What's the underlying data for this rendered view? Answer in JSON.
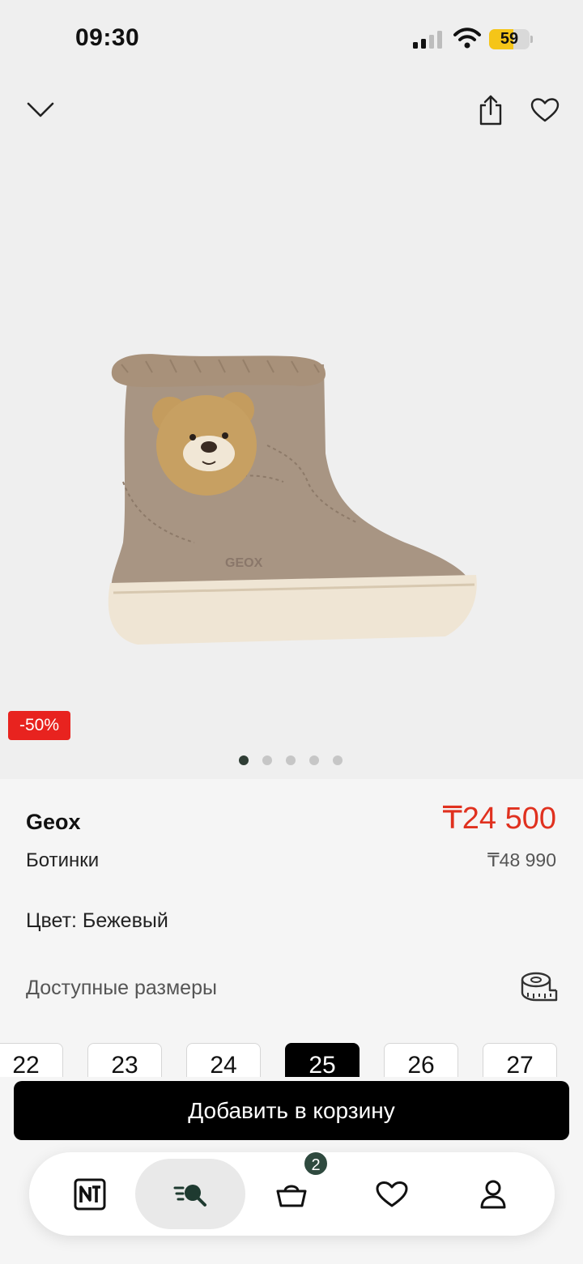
{
  "status_bar": {
    "time": "09:30",
    "battery": "59",
    "battery_level": 0.59
  },
  "product": {
    "discount": "-50%",
    "brand": "Geox",
    "category": "Ботинки",
    "price": "₸24 500",
    "old_price": "₸48 990",
    "color_label": "Цвет: Бежевый",
    "image_slides": 5,
    "active_slide": 1,
    "brand_imprint": "GEOX"
  },
  "sizes": {
    "title": "Доступные размеры",
    "items": [
      "22",
      "23",
      "24",
      "25",
      "26",
      "27"
    ],
    "selected": "25"
  },
  "actions": {
    "add_to_cart": "Добавить в корзину"
  },
  "tab_bar": {
    "cart_count": "2",
    "active_tab": "search"
  },
  "colors": {
    "accent_red": "#e8231f",
    "price_red": "#e0311f",
    "dark_green": "#2f4a3f",
    "battery_yellow": "#f5c518"
  }
}
